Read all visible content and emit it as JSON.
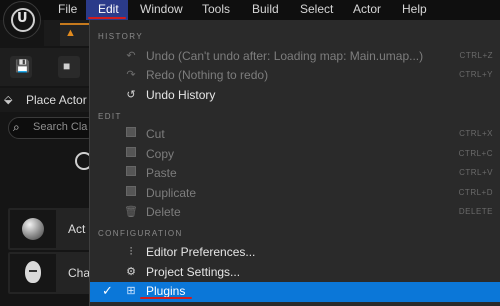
{
  "menubar": {
    "items": [
      "File",
      "Edit",
      "Window",
      "Tools",
      "Build",
      "Select",
      "Actor",
      "Help"
    ],
    "active": "Edit",
    "highlight_color": "#2b3b8a",
    "annotation_color": "#d21d1d"
  },
  "background": {
    "tab_icon": "level-tab-icon",
    "panel_title": "Place Actor",
    "search_placeholder": "Search Cla",
    "actor_items": [
      "Act",
      "Cha"
    ]
  },
  "edit_menu": {
    "sections": [
      {
        "header": "HISTORY",
        "items": [
          {
            "label": "Undo (Can't undo after: Loading map: Main.umap...)",
            "shortcut": "CTRL+Z",
            "icon": "undo-icon",
            "enabled": false
          },
          {
            "label": "Redo (Nothing to redo)",
            "shortcut": "CTRL+Y",
            "icon": "redo-icon",
            "enabled": false
          },
          {
            "label": "Undo History",
            "shortcut": "",
            "icon": "undo-history-icon",
            "enabled": true
          }
        ]
      },
      {
        "header": "EDIT",
        "items": [
          {
            "label": "Cut",
            "shortcut": "CTRL+X",
            "icon": "cut-icon",
            "enabled": false
          },
          {
            "label": "Copy",
            "shortcut": "CTRL+C",
            "icon": "copy-icon",
            "enabled": false
          },
          {
            "label": "Paste",
            "shortcut": "CTRL+V",
            "icon": "paste-icon",
            "enabled": false
          },
          {
            "label": "Duplicate",
            "shortcut": "CTRL+D",
            "icon": "duplicate-icon",
            "enabled": false
          },
          {
            "label": "Delete",
            "shortcut": "DELETE",
            "icon": "delete-icon",
            "enabled": false
          }
        ]
      },
      {
        "header": "CONFIGURATION",
        "items": [
          {
            "label": "Editor Preferences...",
            "shortcut": "",
            "icon": "sliders-icon",
            "enabled": true
          },
          {
            "label": "Project Settings...",
            "shortcut": "",
            "icon": "gear-icon",
            "enabled": true
          },
          {
            "label": "Plugins",
            "shortcut": "",
            "icon": "plugin-icon",
            "enabled": true,
            "selected": true,
            "checked": true
          }
        ]
      }
    ],
    "selected_color": "#0b77d8"
  }
}
